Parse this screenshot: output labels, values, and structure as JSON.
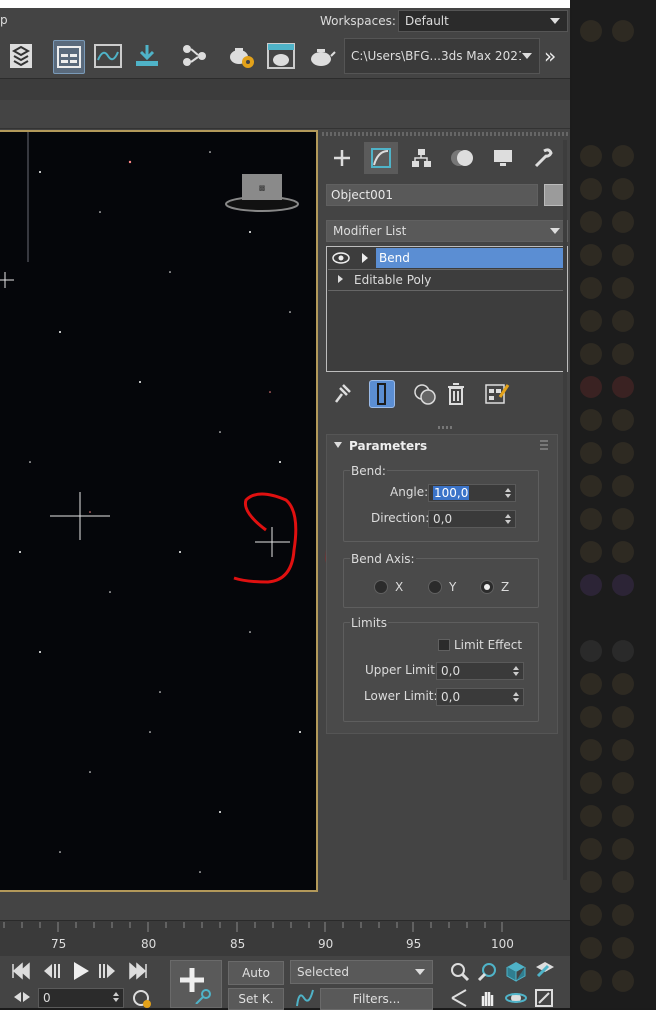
{
  "titlebar": {
    "left_char": "p",
    "workspaces_label": "Workspaces:",
    "workspace_value": "Default"
  },
  "toolbar": {
    "path_value": "C:\\Users\\BFG...3ds Max 2021",
    "more_label": "»"
  },
  "panel": {
    "object_name": "Object001",
    "modifier_list_label": "Modifier List",
    "stack": [
      {
        "label": "Bend",
        "selected": true
      },
      {
        "label": "Editable Poly",
        "selected": false
      }
    ],
    "rollout_title": "Parameters",
    "bend_group": "Bend:",
    "angle_label": "Angle:",
    "angle_value": "100,0",
    "direction_label": "Direction:",
    "direction_value": "0,0",
    "bend_axis_group": "Bend Axis:",
    "axis_x": "X",
    "axis_y": "Y",
    "axis_z": "Z",
    "selected_axis": "Z",
    "limits_group": "Limits",
    "limit_effect_label": "Limit Effect",
    "upper_limit_label": "Upper Limit:",
    "upper_limit_value": "0,0",
    "lower_limit_label": "Lower Limit:",
    "lower_limit_value": "0,0"
  },
  "timeline": {
    "ticks": [
      "75",
      "80",
      "85",
      "90",
      "95",
      "100"
    ]
  },
  "bottom": {
    "frame_value": "0",
    "auto_label": "Auto",
    "setkey_label": "Set K.",
    "selected_dropdown": "Selected",
    "filters_label": "Filters..."
  },
  "annotation": {
    "handwritten": "9)"
  },
  "colors": {
    "accent_blue": "#5b8ed3",
    "annotation_red": "#e01010",
    "viewport_border": "#b3995a"
  }
}
